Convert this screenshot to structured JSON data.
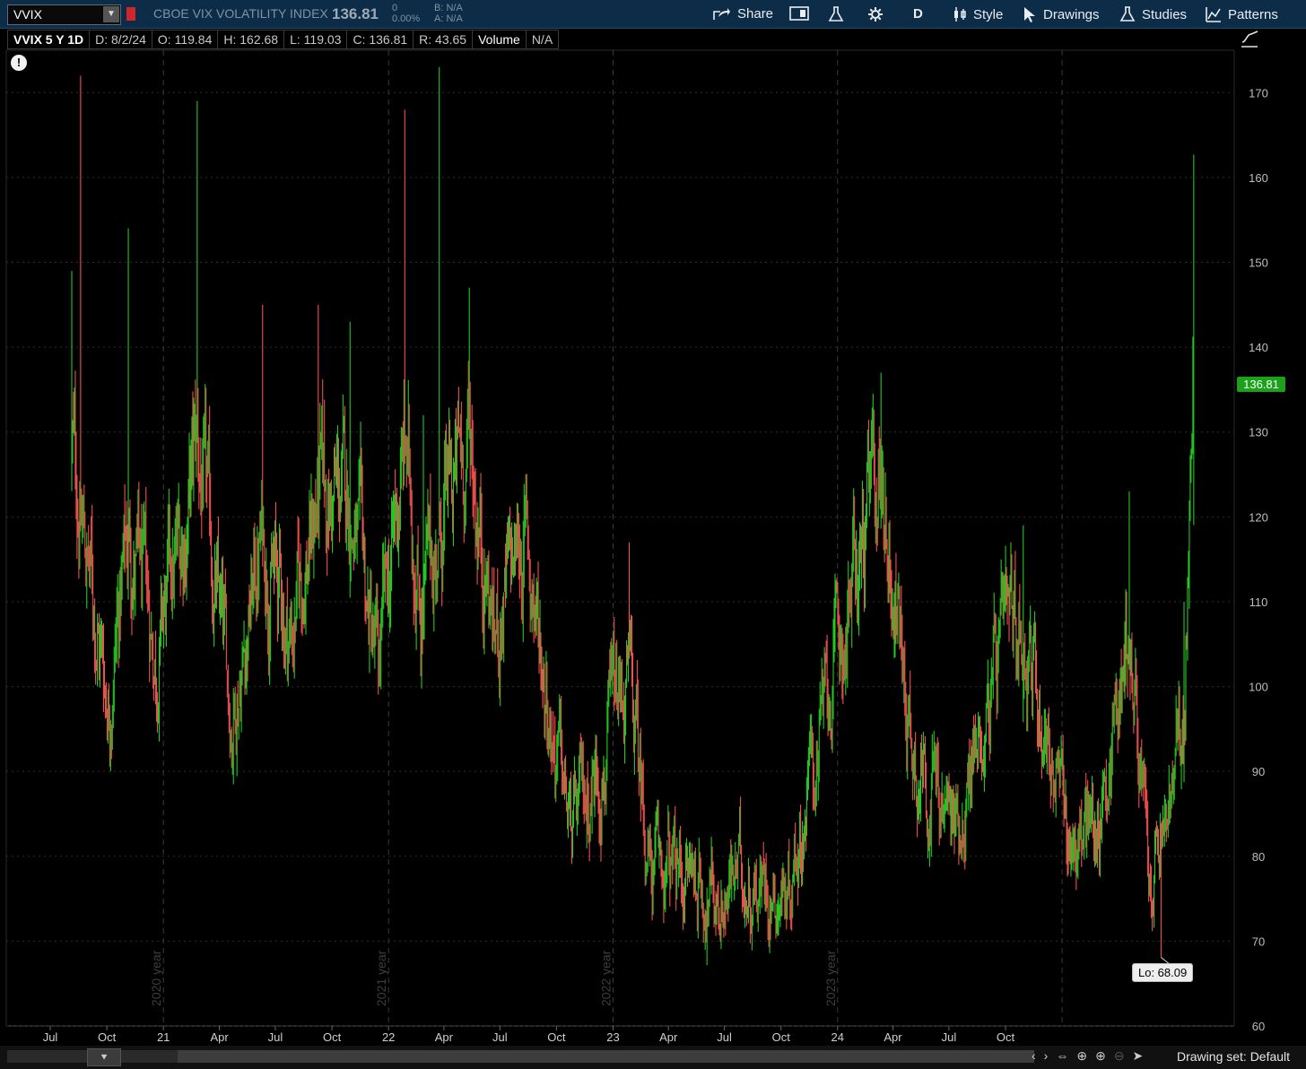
{
  "header": {
    "symbol": "VVIX",
    "description": "CBOE VIX VOLATILITY INDEX",
    "last_price": "136.81",
    "change": "0",
    "change_pct": "0.00%",
    "bid": "B: N/A",
    "ask": "A: N/A",
    "buttons": {
      "share": "Share",
      "aggregation": "D",
      "style": "Style",
      "drawings": "Drawings",
      "studies": "Studies",
      "patterns": "Patterns"
    }
  },
  "info_bar": {
    "name": "VVIX 5 Y 1D",
    "date": "D: 8/2/24",
    "open": "O: 119.84",
    "high": "H: 162.68",
    "low": "L: 119.03",
    "close": "C: 136.81",
    "range": "R: 43.65",
    "volume_label": "Volume",
    "volume_value": "N/A"
  },
  "price_tag": "136.81",
  "low_tag": "Lo: 68.09",
  "footer": {
    "drawing_set": "Drawing set: Default"
  },
  "colors": {
    "up": "#22c922",
    "down": "#f0504f",
    "background": "#000000",
    "price_tag": "#1aa31a"
  },
  "chart_data": {
    "type": "candlestick",
    "title": "",
    "ylim": [
      60,
      175
    ],
    "y_ticks": [
      60,
      70,
      80,
      90,
      100,
      110,
      120,
      130,
      140,
      150,
      160,
      170
    ],
    "x_ticks": [
      "Jul",
      "Oct",
      "21",
      "Apr",
      "Jul",
      "Oct",
      "22",
      "Apr",
      "Jul",
      "Oct",
      "23",
      "Apr",
      "Jul",
      "Oct",
      "24",
      "Apr",
      "Jul",
      "Oct"
    ],
    "year_markers": [
      "2020 year",
      "2021 year",
      "2022 year",
      "2023 year"
    ],
    "grid": true,
    "last_bar": {
      "date": "8/2/24",
      "open": 119.84,
      "high": 162.68,
      "low": 119.03,
      "close": 136.81
    },
    "period_low": 68.09,
    "waypoints": [
      {
        "date": "2019-08-05",
        "close": 128,
        "spike": 149
      },
      {
        "date": "2019-08-20",
        "close": 120,
        "spike": 172
      },
      {
        "date": "2019-10-03",
        "close": 99
      },
      {
        "date": "2019-11-05",
        "close": 118,
        "spike": 154
      },
      {
        "date": "2019-12-20",
        "close": 104
      },
      {
        "date": "2020-01-28",
        "close": 116
      },
      {
        "date": "2020-02-25",
        "close": 128,
        "spike": 169
      },
      {
        "date": "2020-04-20",
        "close": 97
      },
      {
        "date": "2020-06-10",
        "close": 118,
        "spike": 145
      },
      {
        "date": "2020-07-25",
        "close": 106
      },
      {
        "date": "2020-09-08",
        "close": 122,
        "spike": 145
      },
      {
        "date": "2020-10-30",
        "close": 122,
        "spike": 143
      },
      {
        "date": "2020-12-15",
        "close": 101
      },
      {
        "date": "2021-01-27",
        "close": 128,
        "spike": 168
      },
      {
        "date": "2021-02-26",
        "close": 110,
        "spike": 132
      },
      {
        "date": "2021-03-24",
        "close": 118,
        "spike": 173
      },
      {
        "date": "2021-05-13",
        "close": 130,
        "spike": 147
      },
      {
        "date": "2021-06-22",
        "close": 106
      },
      {
        "date": "2021-08-10",
        "close": 118
      },
      {
        "date": "2021-09-08",
        "close": 104
      },
      {
        "date": "2021-10-25",
        "close": 82
      },
      {
        "date": "2021-12-01",
        "close": 90
      },
      {
        "date": "2022-01-27",
        "close": 100,
        "spike": 117
      },
      {
        "date": "2022-03-05",
        "close": 78
      },
      {
        "date": "2022-05-10",
        "close": 78
      },
      {
        "date": "2022-06-17",
        "close": 75
      },
      {
        "date": "2022-08-01",
        "close": 78
      },
      {
        "date": "2022-10-10",
        "close": 76
      },
      {
        "date": "2022-11-20",
        "close": 90
      },
      {
        "date": "2023-03-13",
        "close": 126,
        "spike": 137
      },
      {
        "date": "2023-05-01",
        "close": 94
      },
      {
        "date": "2023-07-10",
        "close": 83
      },
      {
        "date": "2023-09-01",
        "close": 98
      },
      {
        "date": "2023-10-30",
        "close": 108,
        "spike": 119
      },
      {
        "date": "2024-01-10",
        "close": 82
      },
      {
        "date": "2024-03-01",
        "close": 84
      },
      {
        "date": "2024-04-19",
        "close": 108,
        "spike": 123
      },
      {
        "date": "2024-05-22",
        "close": 75
      },
      {
        "date": "2024-06-20",
        "close": 84
      },
      {
        "date": "2024-07-17",
        "close": 95,
        "spike": 110
      },
      {
        "date": "2024-08-02",
        "close": 136.81,
        "spike": 162.68
      }
    ]
  }
}
